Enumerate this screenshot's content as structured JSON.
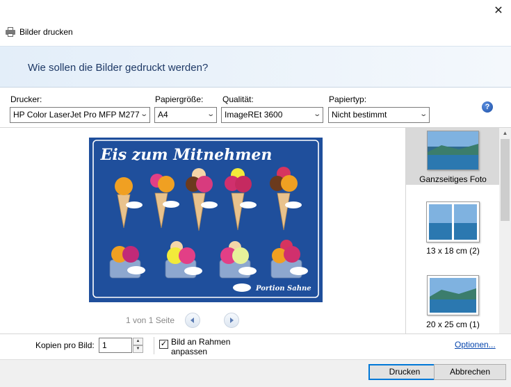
{
  "window": {
    "title": "Bilder drucken",
    "close_glyph": "✕"
  },
  "header": {
    "question": "Wie sollen die Bilder gedruckt werden?"
  },
  "options": {
    "printer": {
      "label": "Drucker:",
      "value": "HP Color LaserJet Pro MFP M277"
    },
    "paper_size": {
      "label": "Papiergröße:",
      "value": "A4"
    },
    "quality": {
      "label": "Qualität:",
      "value": "ImageREt 3600"
    },
    "paper_type": {
      "label": "Papiertyp:",
      "value": "Nicht bestimmt"
    },
    "help_icon": "?"
  },
  "preview": {
    "image_title": "Eis zum Mitnehmen",
    "image_caption": "Portion Sahne",
    "page_indicator": "1 von 1 Seite",
    "colors": {
      "background": "#1f4f9c",
      "frame": "#ffffff"
    }
  },
  "layouts": [
    {
      "label": "Ganzseitiges Foto",
      "selected": true
    },
    {
      "label": "13 x 18 cm (2)",
      "selected": false
    },
    {
      "label": "20 x 25 cm (1)",
      "selected": false
    }
  ],
  "bottom": {
    "copies_label": "Kopien pro Bild:",
    "copies_value": "1",
    "fit_label_line1": "Bild an Rahmen",
    "fit_label_line2": "anpassen",
    "fit_checked": true,
    "options_link": "Optionen..."
  },
  "buttons": {
    "print": "Drucken",
    "cancel": "Abbrechen"
  }
}
